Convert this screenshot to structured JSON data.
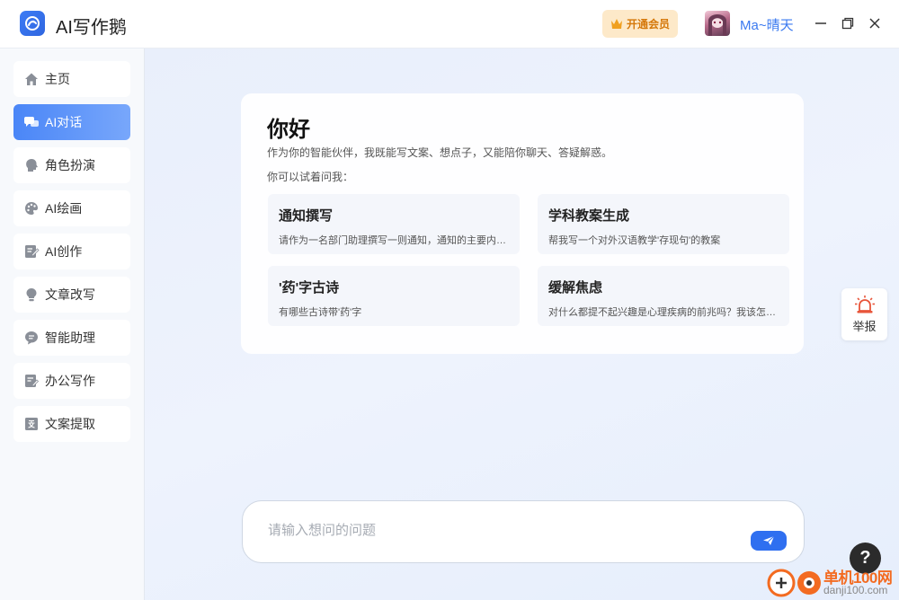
{
  "app": {
    "title": "AI写作鹅"
  },
  "header": {
    "vip_label": "开通会员",
    "username": "Ma~晴天"
  },
  "sidebar": {
    "items": [
      {
        "label": "主页",
        "icon": "home-icon",
        "active": false
      },
      {
        "label": "AI对话",
        "icon": "chat-icon",
        "active": true
      },
      {
        "label": "角色扮演",
        "icon": "role-icon",
        "active": false
      },
      {
        "label": "AI绘画",
        "icon": "palette-icon",
        "active": false
      },
      {
        "label": "AI创作",
        "icon": "edit-icon",
        "active": false
      },
      {
        "label": "文章改写",
        "icon": "bulb-icon",
        "active": false
      },
      {
        "label": "智能助理",
        "icon": "message-icon",
        "active": false
      },
      {
        "label": "办公写作",
        "icon": "document-edit-icon",
        "active": false
      },
      {
        "label": "文案提取",
        "icon": "text-extract-icon",
        "active": false
      }
    ]
  },
  "welcome": {
    "title": "你好",
    "subtitle": "作为你的智能伙伴，我既能写文案、想点子，又能陪你聊天、答疑解惑。",
    "try_label": "你可以试着问我：",
    "suggestions": [
      {
        "title": "通知撰写",
        "desc": "请作为一名部门助理撰写一则通知，通知的主要内容..."
      },
      {
        "title": "学科教案生成",
        "desc": "帮我写一个对外汉语教学'存现句'的教案"
      },
      {
        "title": "'药'字古诗",
        "desc": "有哪些古诗带'药'字"
      },
      {
        "title": "缓解焦虑",
        "desc": "对什么都提不起兴趣是心理疾病的前兆吗？我该怎么..."
      }
    ]
  },
  "report": {
    "label": "举报"
  },
  "input": {
    "placeholder": "请输入想问的问题",
    "value": ""
  },
  "help": {
    "label": "?"
  },
  "watermark": {
    "text": "单机100网",
    "url": "danji100.com"
  },
  "colors": {
    "accent": "#3a79f0",
    "vip": "#d5780a",
    "sidebar_active": "#4a86f7"
  }
}
